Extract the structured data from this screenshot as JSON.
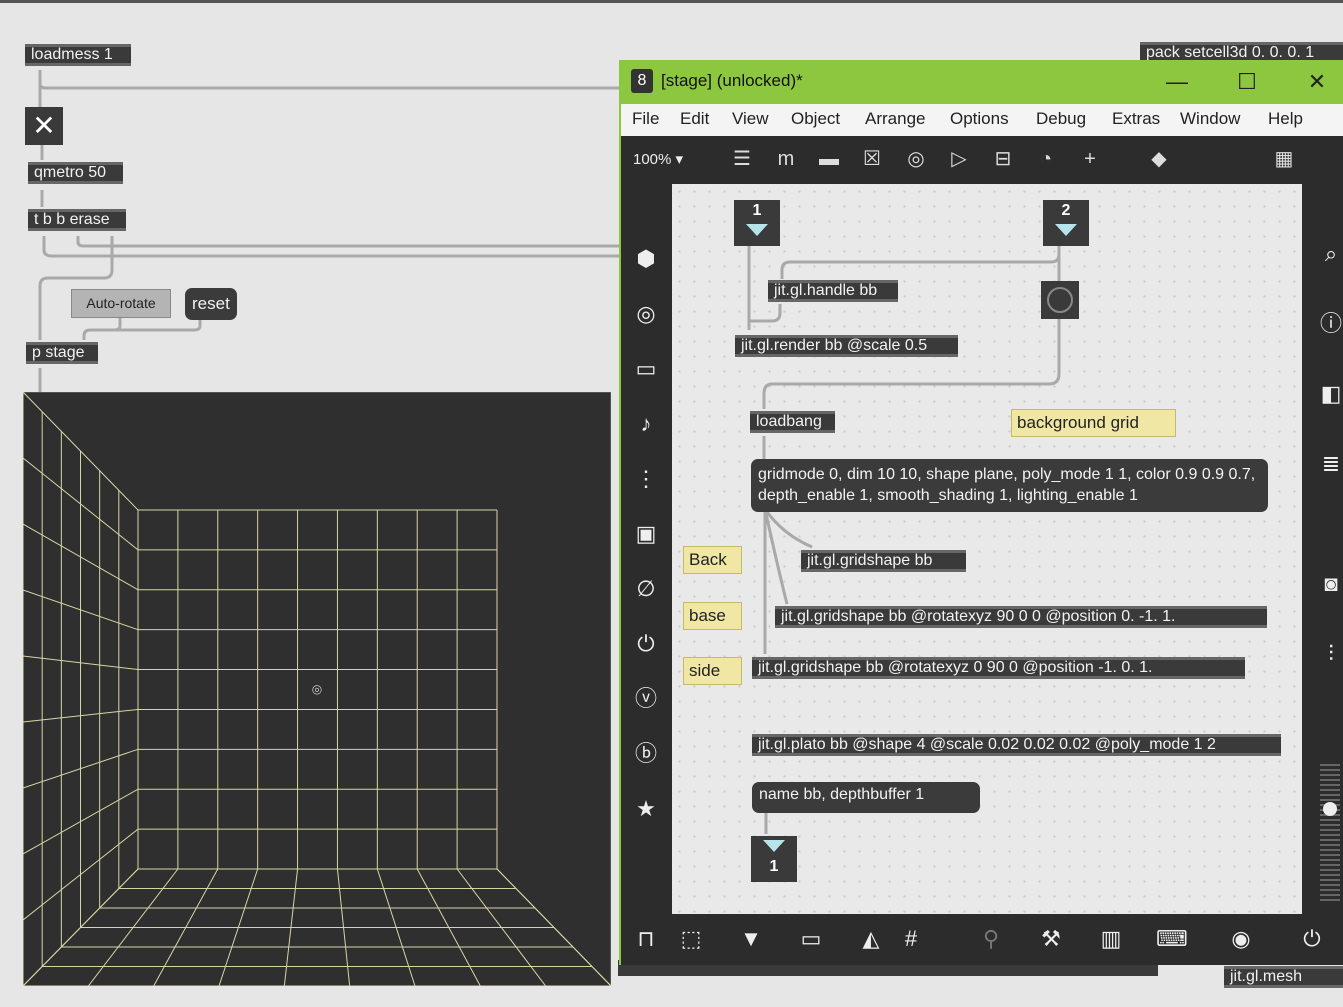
{
  "patcher_left": {
    "loadmess": "loadmess 1",
    "toggle_symbol": "✕",
    "qmetro": "qmetro 50",
    "trigger": "t b b erase",
    "auto_rotate": "Auto-rotate",
    "reset": "reset",
    "pstage": "p stage",
    "behind_top_right": "pack setcell3d 0. 0. 0. 1",
    "behind_bottom_right": "jit.gl.mesh"
  },
  "stage_window": {
    "title": "[stage] (unlocked)*",
    "menu": [
      "File",
      "Edit",
      "View",
      "Object",
      "Arrange",
      "Options",
      "Debug",
      "Extras",
      "Window",
      "Help"
    ],
    "zoom": "100%",
    "objects": {
      "num1": "1",
      "num2": "2",
      "handle": "jit.gl.handle bb",
      "render": "jit.gl.render bb @scale 0.5",
      "loadbang": "loadbang",
      "bg_comment": "background grid",
      "gridmsg": "gridmode 0, dim 10 10, shape plane, poly_mode 1 1, color 0.9 0.9 0.7, depth_enable 1, smooth_shading 1, lighting_enable 1",
      "back": "Back",
      "base": "base",
      "side": "side",
      "gs1": "jit.gl.gridshape bb",
      "gs2": "jit.gl.gridshape bb @rotatexyz 90 0 0 @position 0. -1. 1.",
      "gs3": "jit.gl.gridshape bb @rotatexyz 0 90 0 @position -1. 0. 1.",
      "plato": "jit.gl.plato bb @shape 4 @scale 0.02 0.02 0.02 @poly_mode 1 2",
      "namemsg": "name bb, depthbuffer 1",
      "outnum": "1"
    }
  },
  "colors": {
    "titlebar": "#8dc63f",
    "object_bg": "#3a3a3a",
    "comment_bg": "#f1e7a5",
    "grid_line": "#d9d6a6"
  }
}
